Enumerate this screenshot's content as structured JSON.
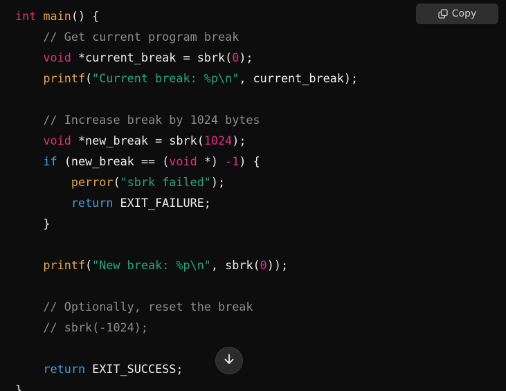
{
  "toolbar": {
    "copy_label": "Copy",
    "copy_icon": "copy-icon"
  },
  "scroll": {
    "icon": "arrow-down-icon"
  },
  "code": {
    "l1": {
      "kw": "int",
      "sp": " ",
      "fn": "main",
      "rest": "() {"
    },
    "l2": {
      "indent": "    ",
      "cmt": "// Get current program break"
    },
    "l3": {
      "indent": "    ",
      "kw": "void",
      "mid": " *current_break = sbrk(",
      "num": "0",
      "end": ");"
    },
    "l4": {
      "indent": "    ",
      "fn": "printf",
      "open": "(",
      "str": "\"Current break: %p\\n\"",
      "end": ", current_break);"
    },
    "l5": {
      "text": ""
    },
    "l6": {
      "indent": "    ",
      "cmt": "// Increase break by 1024 bytes"
    },
    "l7": {
      "indent": "    ",
      "kw": "void",
      "mid": " *new_break = sbrk(",
      "num": "1024",
      "end": ");"
    },
    "l8": {
      "indent": "    ",
      "ctl": "if",
      "mid1": " (new_break == (",
      "kw": "void",
      "mid2": " *) ",
      "num": "-1",
      "end": ") {"
    },
    "l9": {
      "indent": "        ",
      "fn": "perror",
      "open": "(",
      "str": "\"sbrk failed\"",
      "end": ");"
    },
    "l10": {
      "indent": "        ",
      "ctl": "return",
      "end": " EXIT_FAILURE;"
    },
    "l11": {
      "indent": "    ",
      "text": "}"
    },
    "l12": {
      "text": ""
    },
    "l13": {
      "indent": "    ",
      "fn": "printf",
      "open": "(",
      "str": "\"New break: %p\\n\"",
      "mid": ", sbrk(",
      "num": "0",
      "end": "));"
    },
    "l14": {
      "text": ""
    },
    "l15": {
      "indent": "    ",
      "cmt": "// Optionally, reset the break"
    },
    "l16": {
      "indent": "    ",
      "cmt": "// sbrk(-1024);"
    },
    "l17": {
      "text": ""
    },
    "l18": {
      "indent": "    ",
      "ctl": "return",
      "end": " EXIT_SUCCESS;"
    },
    "l19": {
      "text": "}"
    }
  }
}
